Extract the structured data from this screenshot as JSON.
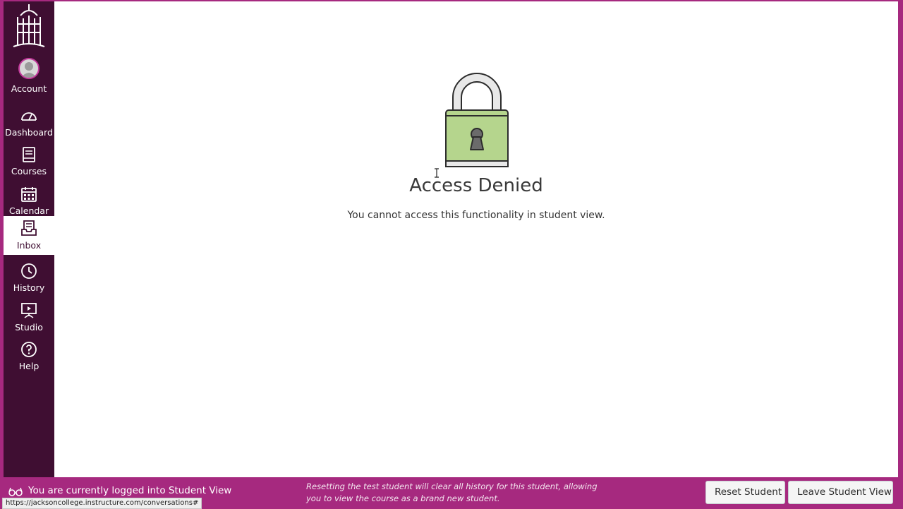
{
  "nav": {
    "items": [
      {
        "label": "Account",
        "icon": "avatar"
      },
      {
        "label": "Dashboard",
        "icon": "dashboard-icon"
      },
      {
        "label": "Courses",
        "icon": "book-icon"
      },
      {
        "label": "Calendar",
        "icon": "calendar-icon"
      },
      {
        "label": "Inbox",
        "icon": "inbox-icon",
        "active": true
      },
      {
        "label": "History",
        "icon": "clock-icon"
      },
      {
        "label": "Studio",
        "icon": "studio-icon"
      },
      {
        "label": "Help",
        "icon": "help-icon"
      }
    ]
  },
  "main": {
    "title": "Access Denied",
    "message": "You cannot access this functionality in student view."
  },
  "student_bar": {
    "status": "You are currently logged into Student View",
    "reset_note": "Resetting the test student will clear all history for this student, allowing you to view the course as a brand new student.",
    "reset_button": "Reset Student",
    "leave_button": "Leave Student View"
  },
  "status_url": "https://jacksoncollege.instructure.com/conversations#",
  "colors": {
    "sidebar": "#3f0e32",
    "student_bar": "#a6297f",
    "lock_body": "#b5d58d"
  }
}
